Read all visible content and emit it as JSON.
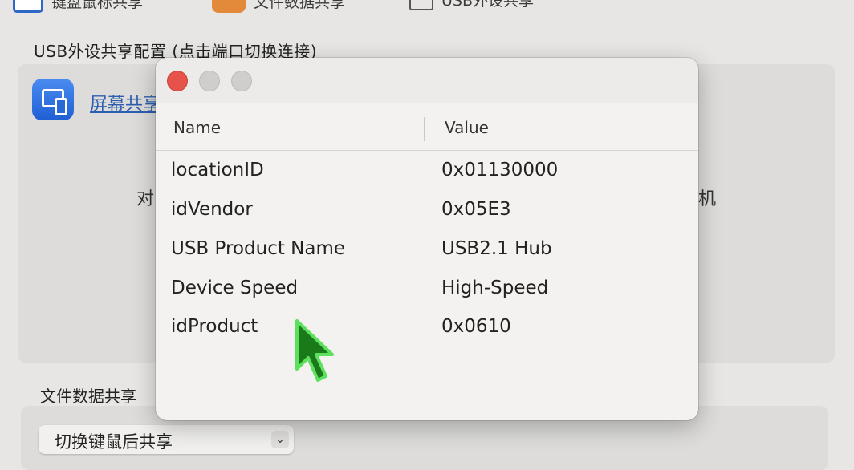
{
  "tabs": [
    {
      "label": "键盘鼠标共享",
      "icon": "keyboard-mouse-icon"
    },
    {
      "label": "文件数据共享",
      "icon": "file-share-icon"
    },
    {
      "label": "USB外设共享",
      "icon": "usb-share-icon"
    }
  ],
  "usb_section": {
    "title": "USB外设共享配置 (点击端口切换连接)",
    "screen_share_label": "屏幕共享",
    "partial_left": "对",
    "partial_right": "机"
  },
  "file_section": {
    "title": "文件数据共享",
    "select_value": "切换键鼠后共享"
  },
  "window": {
    "columns": {
      "name": "Name",
      "value": "Value"
    },
    "rows": [
      {
        "name": "locationID",
        "value": "0x01130000"
      },
      {
        "name": "idVendor",
        "value": "0x05E3"
      },
      {
        "name": "USB Product Name",
        "value": "USB2.1 Hub"
      },
      {
        "name": "Device Speed",
        "value": "High-Speed"
      },
      {
        "name": "idProduct",
        "value": "0x0610"
      }
    ]
  },
  "colors": {
    "accent": "#2d5fb0",
    "close": "#e5534b",
    "cursor": "#1a7a1a"
  }
}
